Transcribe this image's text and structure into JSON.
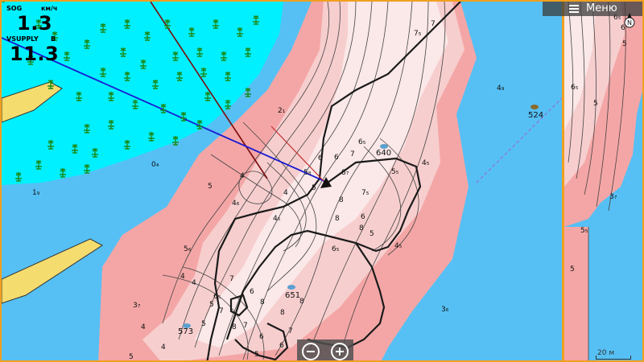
{
  "data_fields": [
    {
      "label": "SOG",
      "unit": "км/ч",
      "value": "1.3"
    },
    {
      "label": "VSUPPLY",
      "unit": "В",
      "value": "11.3"
    }
  ],
  "menu": {
    "label": "Меню"
  },
  "compass": {
    "letter": "N"
  },
  "scale": {
    "label": "20 м"
  },
  "depth_labels": [
    {
      "text": "7"
    },
    {
      "text": "7₅"
    },
    {
      "text": "6₅"
    },
    {
      "text": "6"
    },
    {
      "text": "7"
    },
    {
      "text": "6"
    },
    {
      "text": "8₇"
    },
    {
      "text": "5₅"
    },
    {
      "text": "4₅"
    },
    {
      "text": "5₈"
    },
    {
      "text": "4"
    },
    {
      "text": "5"
    },
    {
      "text": "4"
    },
    {
      "text": "5"
    },
    {
      "text": "4₆"
    },
    {
      "text": "4₅"
    },
    {
      "text": "8"
    },
    {
      "text": "7₅"
    },
    {
      "text": "6"
    },
    {
      "text": "8"
    },
    {
      "text": "8"
    },
    {
      "text": "5"
    },
    {
      "text": "6₅"
    },
    {
      "text": "4₅"
    },
    {
      "text": "5₆"
    },
    {
      "text": "4"
    },
    {
      "text": "5"
    },
    {
      "text": "6₅"
    },
    {
      "text": "4"
    },
    {
      "text": "7"
    },
    {
      "text": "6"
    },
    {
      "text": "7"
    },
    {
      "text": "8"
    },
    {
      "text": "8"
    },
    {
      "text": "3₇"
    },
    {
      "text": "4"
    },
    {
      "text": "5"
    },
    {
      "text": "6"
    },
    {
      "text": "7"
    },
    {
      "text": "7"
    },
    {
      "text": "6"
    },
    {
      "text": "5"
    },
    {
      "text": "4"
    },
    {
      "text": "5"
    },
    {
      "text": "2₁"
    },
    {
      "text": "0₄"
    },
    {
      "text": "1₉"
    },
    {
      "text": "4₉"
    },
    {
      "text": "3₆"
    },
    {
      "text": "8"
    },
    {
      "text": "8"
    }
  ],
  "side_depth_labels": [
    {
      "text": "6₅"
    },
    {
      "text": "6"
    },
    {
      "text": "5"
    },
    {
      "text": "6₅"
    },
    {
      "text": "5"
    },
    {
      "text": "3₇"
    },
    {
      "text": "5₅"
    },
    {
      "text": "5"
    }
  ],
  "waypoints": [
    {
      "id": "640"
    },
    {
      "id": "651"
    },
    {
      "id": "573"
    },
    {
      "id": "524"
    }
  ],
  "colors": {
    "water_deep": "#56c0f4",
    "shallow": "#00f0ff",
    "depth_shallow": "#f4a6a6",
    "depth_mid": "#f7cece",
    "depth_deep": "#fbe8e8",
    "land": "#f5dc6e",
    "frame": "#f0a020",
    "heading_line": "#1a1ad0",
    "course_line": "#7a0a0a"
  }
}
